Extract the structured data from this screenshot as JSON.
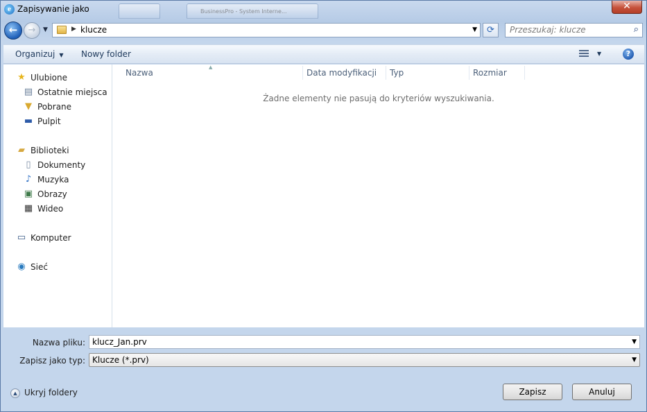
{
  "window": {
    "title": "Zapisywanie jako",
    "close_glyph": "✕"
  },
  "background_tab_text": "BusinessPro - System Interne...",
  "nav": {
    "back_glyph": "←",
    "forward_glyph": "→",
    "address_path": "klucze",
    "search_placeholder": "Przeszukaj: klucze"
  },
  "toolbar": {
    "organize_label": "Organizuj",
    "new_folder_label": "Nowy folder",
    "help_glyph": "?"
  },
  "sidebar": {
    "groups": [
      {
        "label": "Ulubione",
        "icon": "star-icon",
        "items": [
          {
            "label": "Ostatnie miejsca",
            "icon": "recent-places-icon"
          },
          {
            "label": "Pobrane",
            "icon": "downloads-icon"
          },
          {
            "label": "Pulpit",
            "icon": "desktop-icon"
          }
        ]
      },
      {
        "label": "Biblioteki",
        "icon": "libraries-icon",
        "items": [
          {
            "label": "Dokumenty",
            "icon": "documents-icon"
          },
          {
            "label": "Muzyka",
            "icon": "music-icon"
          },
          {
            "label": "Obrazy",
            "icon": "pictures-icon"
          },
          {
            "label": "Wideo",
            "icon": "video-icon"
          }
        ]
      },
      {
        "label": "Komputer",
        "icon": "computer-icon",
        "items": []
      },
      {
        "label": "Sieć",
        "icon": "network-icon",
        "items": []
      }
    ]
  },
  "file_list": {
    "columns": [
      "Nazwa",
      "Data modyfikacji",
      "Typ",
      "Rozmiar"
    ],
    "empty_message": "Żadne elementy nie pasują do kryteriów wyszukiwania."
  },
  "save_form": {
    "filename_label": "Nazwa pliku:",
    "filename_value": "klucz_Jan.prv",
    "filetype_label": "Zapisz jako typ:",
    "filetype_value": "Klucze (*.prv)"
  },
  "footer": {
    "hide_folders_label": "Ukryj foldery",
    "save_button": "Zapisz",
    "cancel_button": "Anuluj"
  }
}
